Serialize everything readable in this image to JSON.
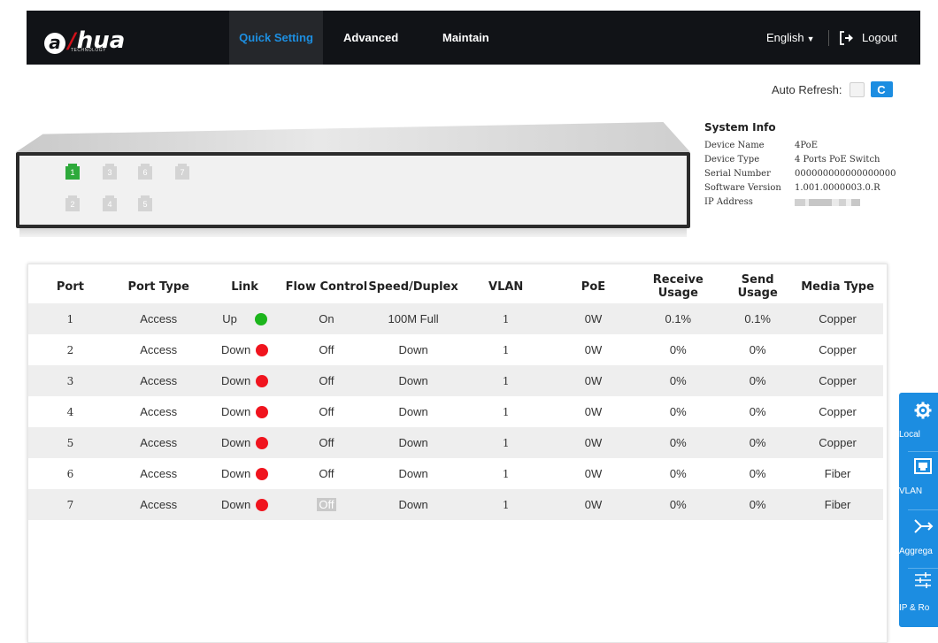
{
  "header": {
    "logo_text": "alhua",
    "logo_sub": "TECHNOLOGY",
    "tabs": [
      {
        "label": "Quick Setting",
        "active": true
      },
      {
        "label": "Advanced",
        "active": false
      },
      {
        "label": "Maintain",
        "active": false
      }
    ],
    "language": "English",
    "logout": "Logout"
  },
  "toolbar": {
    "auto_refresh_label": "Auto Refresh:",
    "auto_refresh_checked": false,
    "refresh_icon": "C"
  },
  "device_panel": {
    "ports": [
      {
        "label": "1",
        "status": "up"
      },
      {
        "label": "3",
        "status": "down"
      },
      {
        "label": "6",
        "status": "down"
      },
      {
        "label": "7",
        "status": "down"
      },
      {
        "label": "2",
        "status": "down"
      },
      {
        "label": "4",
        "status": "down"
      },
      {
        "label": "5",
        "status": "down"
      }
    ]
  },
  "system_info": {
    "title": "System Info",
    "rows": [
      {
        "label": "Device Name",
        "value": "4PoE"
      },
      {
        "label": "Device Type",
        "value": "4 Ports PoE Switch"
      },
      {
        "label": "Serial Number",
        "value": "000000000000000000"
      },
      {
        "label": "Software Version",
        "value": "1.001.0000003.0.R"
      },
      {
        "label": "IP Address",
        "value": ""
      }
    ]
  },
  "port_table": {
    "columns": [
      "Port",
      "Port Type",
      "Link",
      "Flow Control",
      "Speed/Duplex",
      "VLAN",
      "PoE",
      "Receive Usage",
      "Send Usage",
      "Media Type"
    ],
    "rows": [
      {
        "port": "1",
        "type": "Access",
        "link": "Up",
        "link_status": "up",
        "flow": "On",
        "speed": "100M Full",
        "vlan": "1",
        "poe": "0W",
        "rx": "0.1%",
        "tx": "0.1%",
        "media": "Copper"
      },
      {
        "port": "2",
        "type": "Access",
        "link": "Down",
        "link_status": "down",
        "flow": "Off",
        "speed": "Down",
        "vlan": "1",
        "poe": "0W",
        "rx": "0%",
        "tx": "0%",
        "media": "Copper"
      },
      {
        "port": "3",
        "type": "Access",
        "link": "Down",
        "link_status": "down",
        "flow": "Off",
        "speed": "Down",
        "vlan": "1",
        "poe": "0W",
        "rx": "0%",
        "tx": "0%",
        "media": "Copper"
      },
      {
        "port": "4",
        "type": "Access",
        "link": "Down",
        "link_status": "down",
        "flow": "Off",
        "speed": "Down",
        "vlan": "1",
        "poe": "0W",
        "rx": "0%",
        "tx": "0%",
        "media": "Copper"
      },
      {
        "port": "5",
        "type": "Access",
        "link": "Down",
        "link_status": "down",
        "flow": "Off",
        "speed": "Down",
        "vlan": "1",
        "poe": "0W",
        "rx": "0%",
        "tx": "0%",
        "media": "Copper"
      },
      {
        "port": "6",
        "type": "Access",
        "link": "Down",
        "link_status": "down",
        "flow": "Off",
        "speed": "Down",
        "vlan": "1",
        "poe": "0W",
        "rx": "0%",
        "tx": "0%",
        "media": "Fiber"
      },
      {
        "port": "7",
        "type": "Access",
        "link": "Down",
        "link_status": "down",
        "flow": "Off",
        "speed": "Down",
        "vlan": "1",
        "poe": "0W",
        "rx": "0%",
        "tx": "0%",
        "media": "Fiber"
      }
    ]
  },
  "side_menu": {
    "items": [
      {
        "label": "Local",
        "icon": "gear-icon"
      },
      {
        "label": "VLAN",
        "icon": "network-port-icon"
      },
      {
        "label": "Aggrega",
        "icon": "aggregation-icon"
      },
      {
        "label": "IP & Ro",
        "icon": "sliders-icon"
      }
    ]
  },
  "colors": {
    "accent": "#1c8de1",
    "nav_bg": "#111317",
    "link_up": "#1cb51c",
    "link_down": "#f0141e",
    "port_up": "#2eaa3b"
  }
}
